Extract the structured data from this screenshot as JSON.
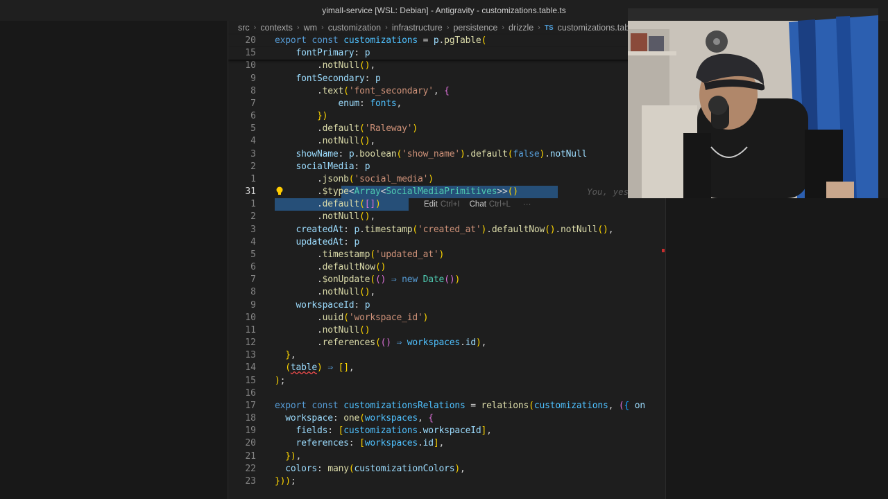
{
  "window": {
    "title": "yimall-service [WSL: Debian] - Antigravity - customizations.table.ts"
  },
  "breadcrumb": {
    "items": [
      "src",
      "contexts",
      "wm",
      "customization",
      "infrastructure",
      "persistence",
      "drizzle"
    ],
    "file_badge": "TS",
    "file": "customizations.table.ts"
  },
  "editor": {
    "inline_hint": {
      "edit": "Edit",
      "edit_key": "Ctrl+I",
      "chat": "Chat",
      "chat_key": "Ctrl+L",
      "more": "···"
    },
    "blame": "You, yesterday",
    "lines": [
      {
        "n": "20",
        "text": "export const customizations = p.pgTable("
      },
      {
        "n": "15",
        "text": "    fontPrimary: p"
      },
      {
        "n": "10",
        "text": "        .notNull(),"
      },
      {
        "n": "9",
        "text": "    fontSecondary: p"
      },
      {
        "n": "8",
        "text": "        .text('font_secondary', {"
      },
      {
        "n": "7",
        "text": "            enum: fonts,"
      },
      {
        "n": "6",
        "text": "        })"
      },
      {
        "n": "5",
        "text": "        .default('Raleway')"
      },
      {
        "n": "4",
        "text": "        .notNull(),"
      },
      {
        "n": "3",
        "text": "    showName: p.boolean('show_name').default(false).notNull"
      },
      {
        "n": "2",
        "text": "    socialMedia: p"
      },
      {
        "n": "1",
        "text": "        .jsonb('social_media')"
      },
      {
        "n": "31",
        "text": "        .$type<Array<SocialMediaPrimitives>>()"
      },
      {
        "n": "1",
        "text": "        .default([])"
      },
      {
        "n": "2",
        "text": "        .notNull(),"
      },
      {
        "n": "3",
        "text": "    createdAt: p.timestamp('created_at').defaultNow().notNull(),"
      },
      {
        "n": "4",
        "text": "    updatedAt: p"
      },
      {
        "n": "5",
        "text": "        .timestamp('updated_at')"
      },
      {
        "n": "6",
        "text": "        .defaultNow()"
      },
      {
        "n": "7",
        "text": "        .$onUpdate(() ⇒ new Date())"
      },
      {
        "n": "8",
        "text": "        .notNull(),"
      },
      {
        "n": "9",
        "text": "    workspaceId: p"
      },
      {
        "n": "10",
        "text": "        .uuid('workspace_id')"
      },
      {
        "n": "11",
        "text": "        .notNull()"
      },
      {
        "n": "12",
        "text": "        .references(() ⇒ workspaces.id),"
      },
      {
        "n": "13",
        "text": "  },"
      },
      {
        "n": "14",
        "text": "  (table) ⇒ [],"
      },
      {
        "n": "15",
        "text": ");"
      },
      {
        "n": "16",
        "text": ""
      },
      {
        "n": "17",
        "text": "export const customizationsRelations = relations(customizations, ({ on"
      },
      {
        "n": "18",
        "text": "  workspace: one(workspaces, {"
      },
      {
        "n": "19",
        "text": "    fields: [customizations.workspaceId],"
      },
      {
        "n": "20",
        "text": "    references: [workspaces.id],"
      },
      {
        "n": "21",
        "text": "  }),"
      },
      {
        "n": "22",
        "text": "  colors: many(customizationColors),"
      },
      {
        "n": "23",
        "text": "}));"
      }
    ]
  },
  "colors": {
    "keyword": "#569cd6",
    "function": "#dcdcaa",
    "string": "#ce9178",
    "property": "#9cdcfe",
    "type": "#4ec9b0",
    "selection": "#264f78"
  }
}
